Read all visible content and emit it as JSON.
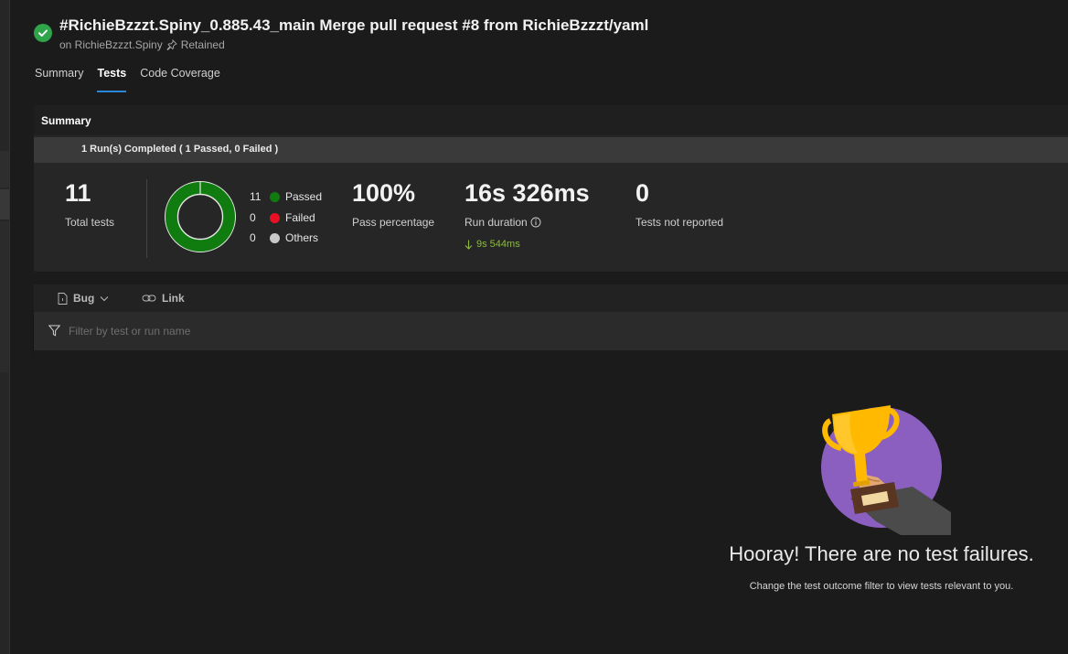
{
  "header": {
    "title": "#RichieBzzzt.Spiny_0.885.43_main Merge pull request #8 from RichieBzzzt/yaml",
    "subtitle_project": "on RichieBzzzt.Spiny",
    "retained_label": "Retained",
    "status": "succeeded"
  },
  "tabs": [
    {
      "label": "Summary",
      "active": false
    },
    {
      "label": "Tests",
      "active": true
    },
    {
      "label": "Code Coverage",
      "active": false
    }
  ],
  "summary": {
    "heading": "Summary",
    "run_status": "1 Run(s) Completed ( 1 Passed, 0 Failed )",
    "total_tests": {
      "value": "11",
      "label": "Total tests"
    },
    "outcomes": [
      {
        "count": "11",
        "label": "Passed",
        "color": "#107c10"
      },
      {
        "count": "0",
        "label": "Failed",
        "color": "#e81123"
      },
      {
        "count": "0",
        "label": "Others",
        "color": "#c8c8c8"
      }
    ],
    "pass_percentage": {
      "value": "100%",
      "label": "Pass percentage"
    },
    "run_duration": {
      "value": "16s 326ms",
      "label": "Run duration",
      "delta": "9s 544ms"
    },
    "not_reported": {
      "value": "0",
      "label": "Tests not reported"
    }
  },
  "toolbar": {
    "bug_label": "Bug",
    "link_label": "Link"
  },
  "filter": {
    "placeholder": "Filter by test or run name"
  },
  "empty_state": {
    "title": "Hooray! There are no test failures.",
    "message": "Change the test outcome filter to view tests relevant to you."
  },
  "colors": {
    "accent": "#2b88d8",
    "success": "#2fa44a",
    "delta_good": "#8dbb3f",
    "trophy_bg": "#8a5fbf"
  }
}
